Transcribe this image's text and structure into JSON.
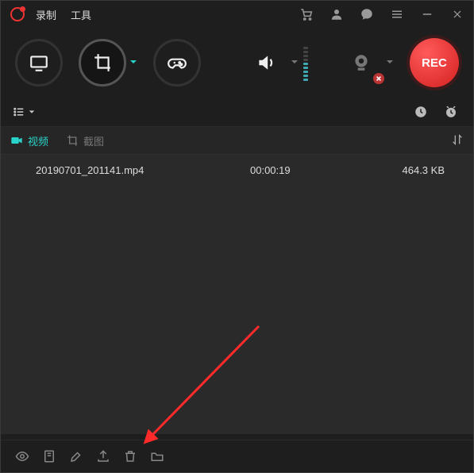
{
  "title": {
    "menu_record": "录制",
    "menu_tools": "工具"
  },
  "rec": {
    "label": "REC"
  },
  "tabs": {
    "video": "视频",
    "screenshot": "截图"
  },
  "files": [
    {
      "name": "20190701_201141.mp4",
      "duration": "00:00:19",
      "size": "464.3 KB"
    }
  ]
}
